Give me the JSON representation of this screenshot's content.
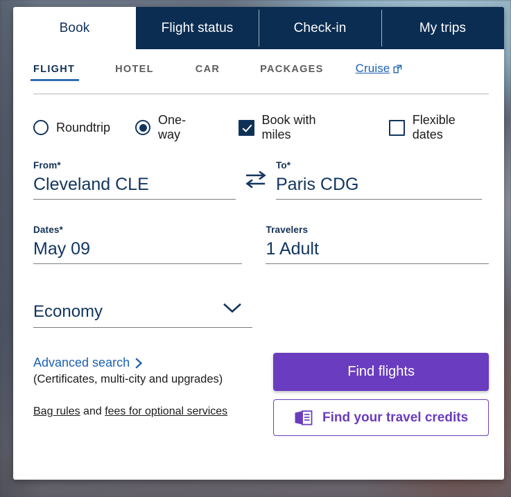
{
  "colors": {
    "navy": "#0b2d52",
    "link_blue": "#1c61b5",
    "accent_purple": "#6a3cc0",
    "field_navy": "#11355f"
  },
  "tabs": [
    {
      "label": "Book",
      "active": true
    },
    {
      "label": "Flight status",
      "active": false
    },
    {
      "label": "Check-in",
      "active": false
    },
    {
      "label": "My trips",
      "active": false
    }
  ],
  "subtabs": [
    {
      "label": "FLIGHT",
      "active": true
    },
    {
      "label": "HOTEL",
      "active": false
    },
    {
      "label": "CAR",
      "active": false
    },
    {
      "label": "PACKAGES",
      "active": false
    },
    {
      "label": "Cruise",
      "active": false,
      "external": true
    }
  ],
  "trip_options": {
    "roundtrip": {
      "label": "Roundtrip",
      "selected": false
    },
    "oneway": {
      "label": "One-way",
      "selected": true
    },
    "book_with_miles": {
      "label": "Book with miles",
      "checked": true
    },
    "flexible_dates": {
      "label": "Flexible dates",
      "checked": false
    }
  },
  "fields": {
    "from": {
      "label": "From*",
      "value": "Cleveland CLE"
    },
    "to": {
      "label": "To*",
      "value": "Paris CDG"
    },
    "dates": {
      "label": "Dates*",
      "value": "May 09"
    },
    "travelers": {
      "label": "Travelers",
      "value": "1 Adult"
    },
    "cabin": {
      "value": "Economy"
    }
  },
  "footer": {
    "advanced_search": "Advanced search",
    "advanced_note": "(Certificates, multi-city and upgrades)",
    "bag_rules": "Bag rules",
    "bag_conjunction": " and ",
    "fees_link": "fees for optional services",
    "find_flights": "Find flights",
    "travel_credits": "Find your travel credits"
  },
  "icons": {
    "swap": "swap-arrows-icon",
    "chevron_down": "chevron-down-icon",
    "chevron_right": "chevron-right-icon",
    "external_link": "external-link-icon",
    "voucher": "travel-credit-voucher-icon"
  }
}
